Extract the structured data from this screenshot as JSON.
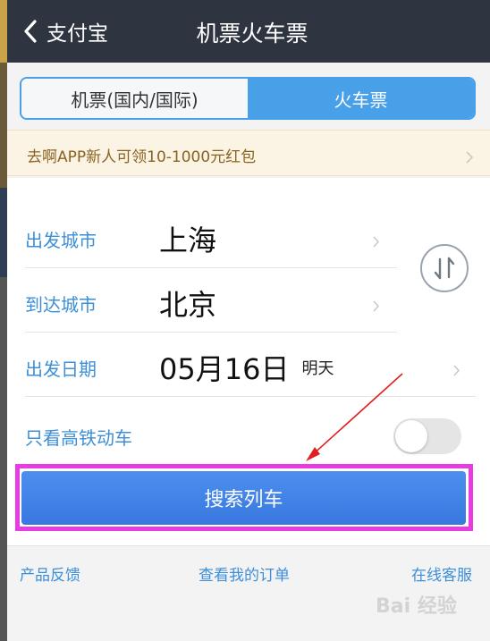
{
  "header": {
    "back_label": "支付宝",
    "title": "机票火车票"
  },
  "tabs": [
    {
      "label": "机票(国内/国际)",
      "active": false
    },
    {
      "label": "火车票",
      "active": true
    }
  ],
  "promo": {
    "text": "去啊APP新人可领10-1000元红包"
  },
  "form": {
    "departure": {
      "label": "出发城市",
      "value": "上海"
    },
    "arrival": {
      "label": "到达城市",
      "value": "北京"
    },
    "date": {
      "label": "出发日期",
      "value": "05月16日",
      "note": "明天"
    },
    "high_speed_only": {
      "label": "只看高铁动车",
      "on": false
    }
  },
  "search_button": {
    "label": "搜索列车"
  },
  "footer": {
    "feedback": "产品反馈",
    "my_orders": "查看我的订单",
    "customer_service": "在线客服"
  },
  "watermark": "Bai 经验",
  "colors": {
    "header_bg": "#2e3440",
    "accent_blue": "#48a0e8",
    "button_blue": "#3d82e6",
    "annotation_magenta": "#e83ce2",
    "annotation_arrow": "#e02020"
  }
}
